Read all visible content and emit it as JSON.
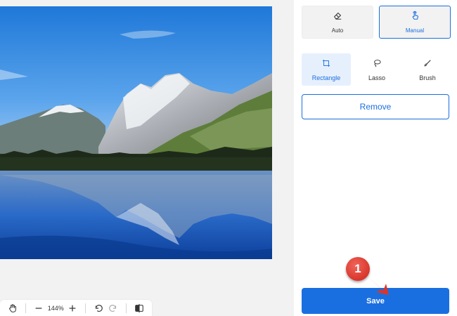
{
  "toolbar": {
    "zoom_level": "144%",
    "icons": [
      "hand-icon",
      "zoom-out-icon",
      "zoom-in-icon",
      "undo-icon",
      "redo-icon",
      "compare-icon"
    ]
  },
  "panel": {
    "modes": [
      {
        "label": "Auto",
        "icon": "eraser-icon",
        "active": false
      },
      {
        "label": "Manual",
        "icon": "hand-pointer-icon",
        "active": true
      }
    ],
    "tools": [
      {
        "label": "Rectangle",
        "icon": "rectangle-select-icon",
        "active": true
      },
      {
        "label": "Lasso",
        "icon": "lasso-icon",
        "active": false
      },
      {
        "label": "Brush",
        "icon": "brush-icon",
        "active": false
      }
    ],
    "remove_label": "Remove",
    "save_label": "Save"
  },
  "callout": {
    "number": "1"
  },
  "colors": {
    "accent": "#1a6fe0",
    "callout": "#e2443a",
    "panel_bg": "#ffffff",
    "canvas_bg": "#f2f2f2"
  }
}
